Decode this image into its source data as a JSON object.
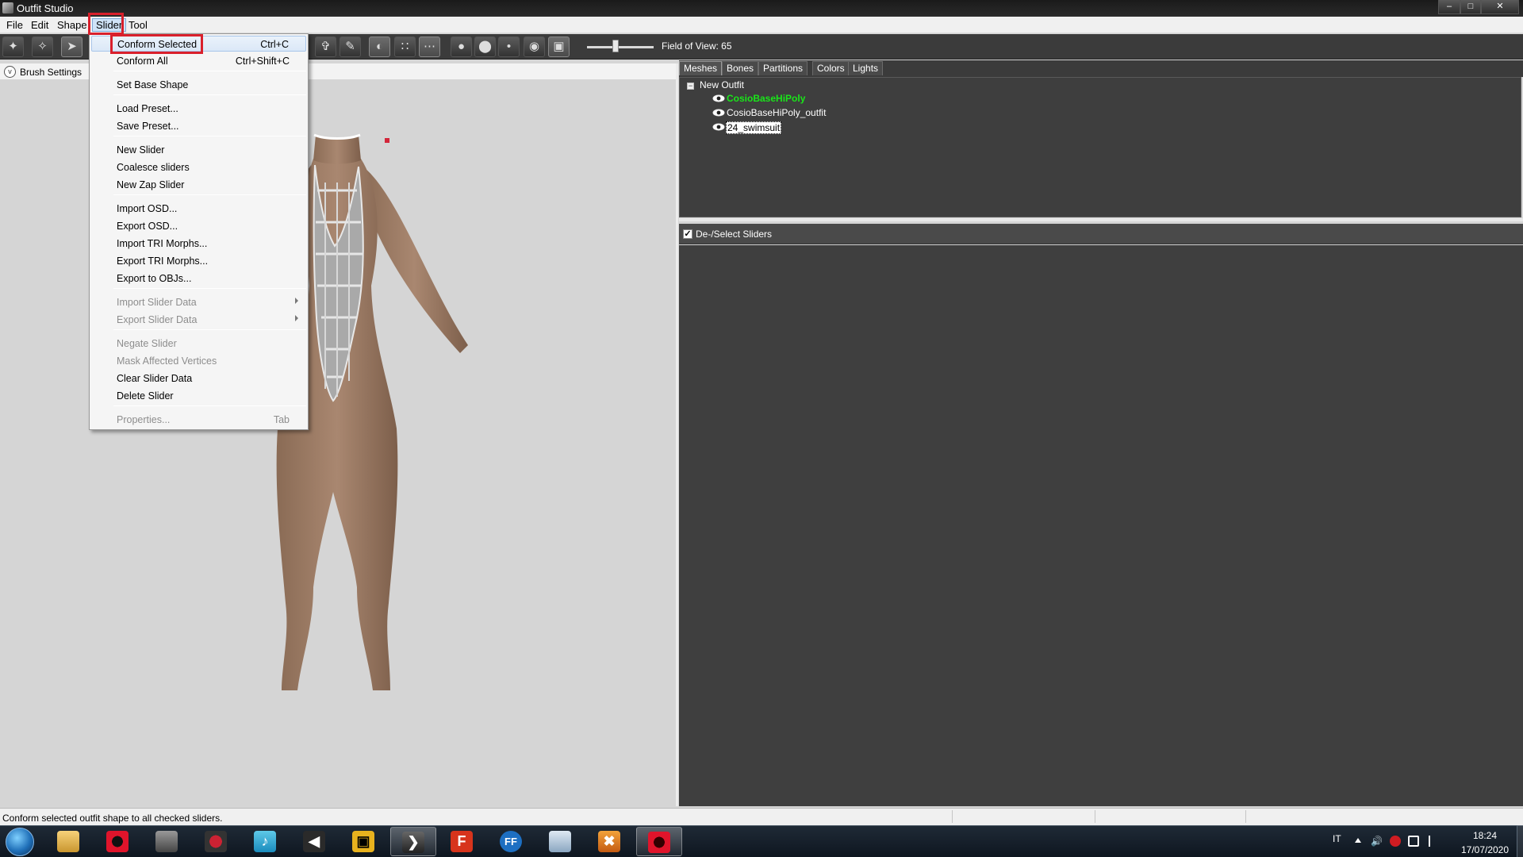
{
  "window": {
    "title": "Outfit Studio",
    "min": "–",
    "max": "□",
    "close": "✕"
  },
  "menubar": [
    "File",
    "Edit",
    "Shape",
    "Slider",
    "Tool"
  ],
  "toolbar": {
    "fov_label": "Field of View: 65"
  },
  "brush_settings": {
    "label": "Brush Settings",
    "chevron": "v"
  },
  "tabs": [
    "Meshes",
    "Bones",
    "Partitions",
    "Colors",
    "Lights"
  ],
  "tree": {
    "expand": "−",
    "root": "New Outfit",
    "items": [
      "CosioBaseHiPoly",
      "CosioBaseHiPoly_outfit",
      "24_swimsuit"
    ]
  },
  "sliders": {
    "check": "✓",
    "label": "De-/Select Sliders"
  },
  "slider_menu": {
    "items": [
      {
        "label": "Conform Selected",
        "shortcut": "Ctrl+C"
      },
      {
        "label": "Conform All",
        "shortcut": "Ctrl+Shift+C"
      },
      {
        "label": "Set Base Shape",
        "shortcut": ""
      },
      {
        "label": "Load Preset...",
        "shortcut": ""
      },
      {
        "label": "Save Preset...",
        "shortcut": ""
      },
      {
        "label": "New Slider",
        "shortcut": ""
      },
      {
        "label": "Coalesce sliders",
        "shortcut": ""
      },
      {
        "label": "New Zap Slider",
        "shortcut": ""
      },
      {
        "label": "Import OSD...",
        "shortcut": ""
      },
      {
        "label": "Export OSD...",
        "shortcut": ""
      },
      {
        "label": "Import TRI Morphs...",
        "shortcut": ""
      },
      {
        "label": "Export TRI Morphs...",
        "shortcut": ""
      },
      {
        "label": "Export to OBJs...",
        "shortcut": ""
      },
      {
        "label": "Import Slider Data",
        "shortcut": ""
      },
      {
        "label": "Export Slider Data",
        "shortcut": ""
      },
      {
        "label": "Negate Slider",
        "shortcut": ""
      },
      {
        "label": "Mask Affected Vertices",
        "shortcut": ""
      },
      {
        "label": "Clear Slider Data",
        "shortcut": ""
      },
      {
        "label": "Delete Slider",
        "shortcut": ""
      },
      {
        "label": "Properties...",
        "shortcut": "Tab"
      }
    ]
  },
  "status": {
    "text": "Conform selected outfit shape to all checked sliders."
  },
  "taskbar": {
    "icons": [
      "opera-icon",
      "folder-icon",
      "media-icon",
      "game-icon",
      "music-icon",
      "audio-icon",
      "jdownloader-icon",
      "outfit-studio-icon",
      "f-app-icon",
      "ffdec-icon",
      "window-icon",
      "tool-icon",
      "opera-red-icon"
    ],
    "lang": "IT",
    "time": "18:24",
    "date": "17/07/2020",
    "label_f": "F",
    "label_ff": "FF"
  },
  "colors": {
    "accent_red": "#d9202c",
    "mesh_active": "#19e619"
  }
}
